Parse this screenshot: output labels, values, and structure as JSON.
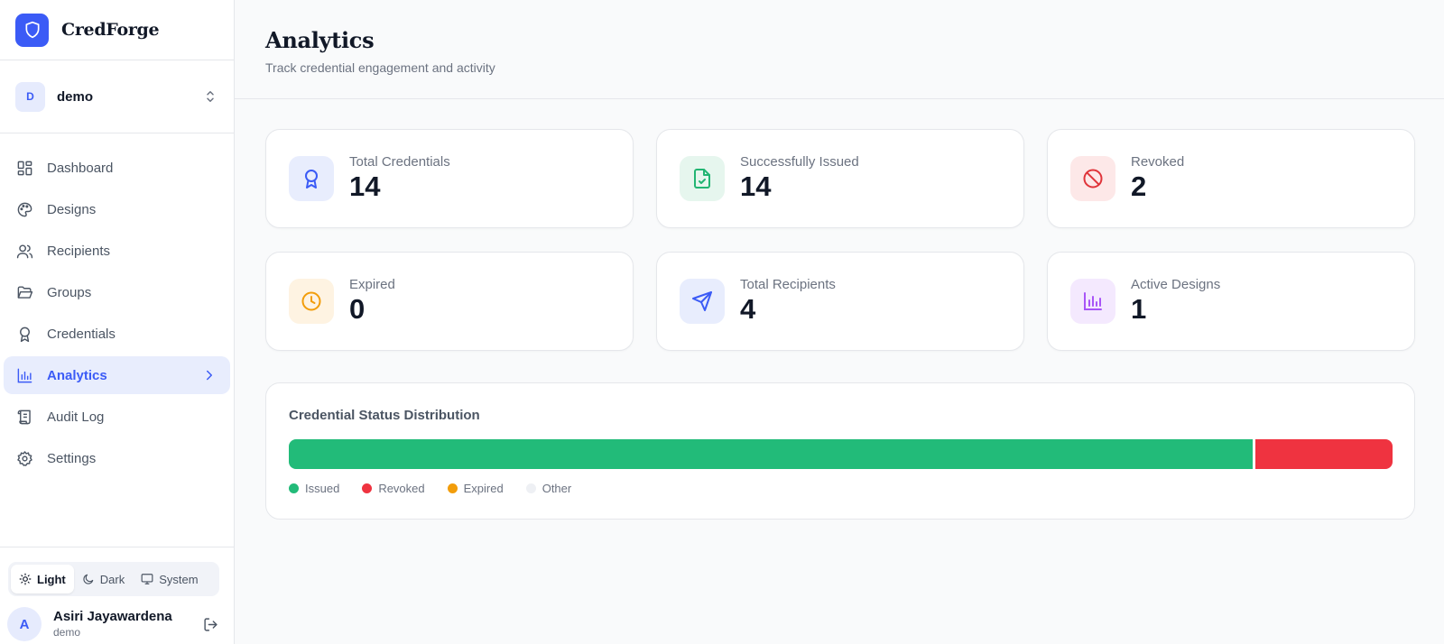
{
  "brand": {
    "name": "CredForge"
  },
  "org": {
    "initial": "D",
    "name": "demo"
  },
  "nav": {
    "items": [
      {
        "label": "Dashboard",
        "icon": "dashboard-icon"
      },
      {
        "label": "Designs",
        "icon": "palette-icon"
      },
      {
        "label": "Recipients",
        "icon": "users-icon"
      },
      {
        "label": "Groups",
        "icon": "folder-icon"
      },
      {
        "label": "Credentials",
        "icon": "award-icon"
      },
      {
        "label": "Analytics",
        "icon": "bar-chart-icon",
        "active": true
      },
      {
        "label": "Audit Log",
        "icon": "scroll-icon"
      },
      {
        "label": "Settings",
        "icon": "gear-icon"
      }
    ]
  },
  "theme": {
    "light": "Light",
    "dark": "Dark",
    "system": "System",
    "selected": "Light"
  },
  "user": {
    "initial": "A",
    "name": "Asiri Jayawardena",
    "org": "demo"
  },
  "header": {
    "title": "Analytics",
    "subtitle": "Track credential engagement and activity"
  },
  "stats": [
    {
      "label": "Total Credentials",
      "value": "14",
      "icon": "award-icon",
      "color": "#3b5bf6",
      "bg": "#e8edfd"
    },
    {
      "label": "Successfully Issued",
      "value": "14",
      "icon": "file-check-icon",
      "color": "#22b573",
      "bg": "#e6f6ee"
    },
    {
      "label": "Revoked",
      "value": "2",
      "icon": "ban-icon",
      "color": "#e0343a",
      "bg": "#fde8e8"
    },
    {
      "label": "Expired",
      "value": "0",
      "icon": "clock-icon",
      "color": "#f29d0b",
      "bg": "#fef3e2"
    },
    {
      "label": "Total Recipients",
      "value": "4",
      "icon": "send-icon",
      "color": "#3b5bf6",
      "bg": "#e8edfd"
    },
    {
      "label": "Active Designs",
      "value": "1",
      "icon": "bar-chart-icon",
      "color": "#a855f7",
      "bg": "#f4e9fe"
    }
  ],
  "distribution": {
    "title": "Credential Status Distribution",
    "segments": [
      {
        "name": "Issued",
        "value": 14,
        "color": "#22bb79"
      },
      {
        "name": "Revoked",
        "value": 2,
        "color": "#ef3340"
      },
      {
        "name": "Expired",
        "value": 0,
        "color": "#f29d0b"
      },
      {
        "name": "Other",
        "value": 0,
        "color": "#eef0f4"
      }
    ]
  }
}
